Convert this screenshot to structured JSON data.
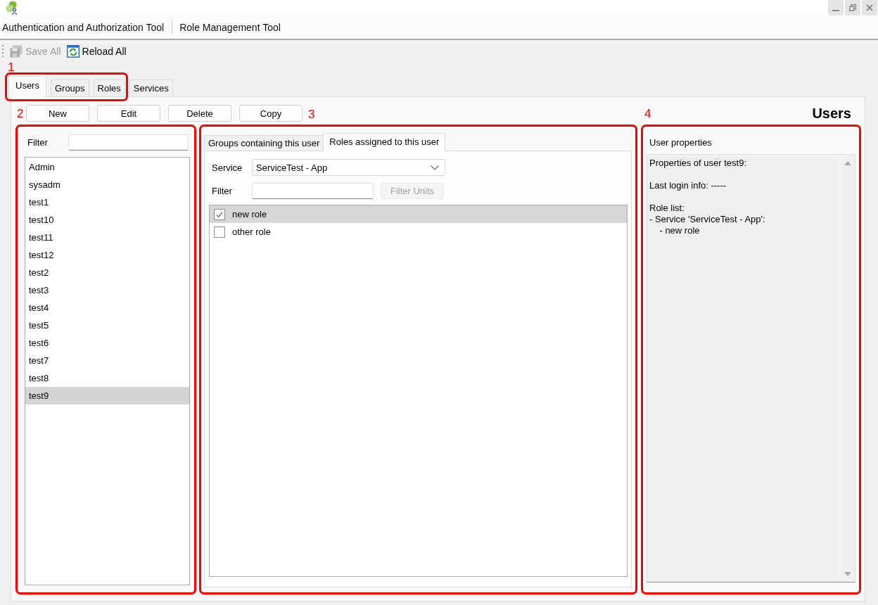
{
  "menu": [
    "Authentication and Authorization Tool",
    "Role Management Tool"
  ],
  "toolbar": [
    {
      "kind": "save",
      "label": "Save All",
      "disabled": true
    },
    {
      "kind": "reload",
      "label": "Reload All",
      "disabled": false
    }
  ],
  "tabs": [
    {
      "label": "Users",
      "selected": true
    },
    {
      "label": "Groups",
      "selected": false
    },
    {
      "label": "Roles",
      "selected": false
    },
    {
      "label": "Services",
      "selected": false
    }
  ],
  "actions": [
    "New",
    "Edit",
    "Delete",
    "Copy"
  ],
  "heading": "Users",
  "users_panel": {
    "filter_label": "Filter",
    "items": [
      {
        "label": "Admin",
        "selected": false
      },
      {
        "label": "sysadm",
        "selected": false
      },
      {
        "label": "test1",
        "selected": false
      },
      {
        "label": "test10",
        "selected": false
      },
      {
        "label": "test11",
        "selected": false
      },
      {
        "label": "test12",
        "selected": false
      },
      {
        "label": "test2",
        "selected": false
      },
      {
        "label": "test3",
        "selected": false
      },
      {
        "label": "test4",
        "selected": false
      },
      {
        "label": "test5",
        "selected": false
      },
      {
        "label": "test6",
        "selected": false
      },
      {
        "label": "test7",
        "selected": false
      },
      {
        "label": "test8",
        "selected": false
      },
      {
        "label": "test9",
        "selected": true
      }
    ]
  },
  "roles_panel": {
    "tabs": [
      {
        "label": "Groups containing this user",
        "selected": false
      },
      {
        "label": "Roles assigned to this user",
        "selected": true
      }
    ],
    "service_label": "Service",
    "service_value": "ServiceTest - App",
    "filter_label": "Filter",
    "filter_button": {
      "label": "Filter Units",
      "disabled": true
    },
    "roles": [
      {
        "label": "new role",
        "checked": true,
        "selected": true
      },
      {
        "label": "other role",
        "checked": false,
        "selected": false
      }
    ]
  },
  "properties_panel": {
    "label": "User properties",
    "text": "Properties of user test9:\n\nLast login info: -----\n\nRole list:\n- Service 'ServiceTest - App':\n    - new role"
  },
  "annotations": [
    {
      "label": "1"
    },
    {
      "label": "2"
    },
    {
      "label": "3"
    },
    {
      "label": "4"
    }
  ]
}
